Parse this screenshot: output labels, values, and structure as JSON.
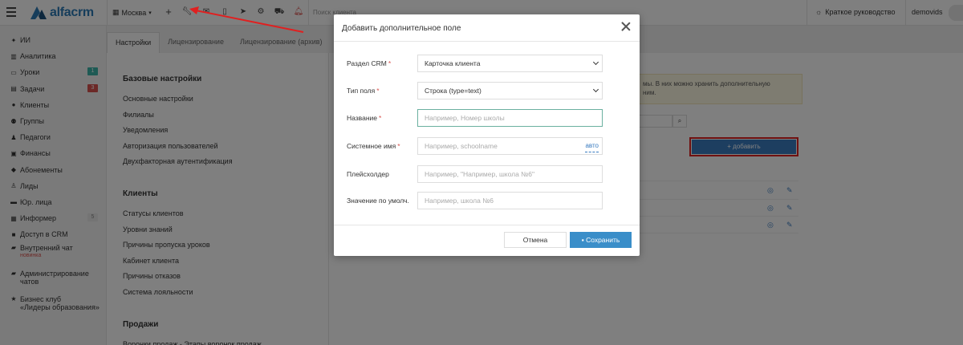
{
  "topbar": {
    "logo_text": "alfacrm",
    "city": "Москва",
    "search_placeholder": "Поиск клиента",
    "guide_label": "Краткое руководство",
    "username": "demovids"
  },
  "sidebar": {
    "items": [
      {
        "label": "ИИ",
        "icon": "sparkle-icon"
      },
      {
        "label": "Аналитика",
        "icon": "chart-icon"
      },
      {
        "label": "Уроки",
        "icon": "lessons-icon",
        "badge": "1",
        "badge_color": "#3cb4a8"
      },
      {
        "label": "Задачи",
        "icon": "tasks-icon",
        "badge": "3",
        "badge_color": "#d9534f"
      },
      {
        "label": "Клиенты",
        "icon": "user-icon"
      },
      {
        "label": "Группы",
        "icon": "group-icon"
      },
      {
        "label": "Педагоги",
        "icon": "teacher-icon"
      },
      {
        "label": "Финансы",
        "icon": "finance-icon"
      },
      {
        "label": "Абонементы",
        "icon": "tag-icon"
      },
      {
        "label": "Лиды",
        "icon": "leads-icon"
      },
      {
        "label": "Юр. лица",
        "icon": "briefcase-icon"
      },
      {
        "label": "Информер",
        "icon": "informer-icon",
        "badge": "5",
        "badge_color": "#e8e8e8"
      },
      {
        "label": "Доступ в CRM",
        "icon": "lock-icon"
      }
    ],
    "chat_label": "Внутренний чат",
    "chat_new": "новинка",
    "admin_chats": "Администрирование чатов",
    "business_club_line1": "Бизнес клуб",
    "business_club_line2": "«Лидеры образования»"
  },
  "tabs": [
    {
      "label": "Настройки"
    },
    {
      "label": "Лицензирование"
    },
    {
      "label": "Лицензирование (архив)"
    }
  ],
  "settings_menu": {
    "base_title": "Базовые настройки",
    "base_items": [
      "Основные настройки",
      "Филиалы",
      "Уведомления",
      "Авторизация пользователей",
      "Двухфакторная аутентификация"
    ],
    "clients_title": "Клиенты",
    "clients_items": [
      "Статусы клиентов",
      "Уровни знаний",
      "Причины пропуска уроков",
      "Кабинет клиента",
      "Причины отказов",
      "Система лояльности"
    ],
    "sales_title": "Продажи",
    "sales_items": [
      "Воронки продаж - Этапы воронок продаж"
    ]
  },
  "background": {
    "notice_line1": "мы. В них можно хранить дополнительную",
    "notice_line2": "ним.",
    "add_button": "+ добавить"
  },
  "modal": {
    "title": "Добавить дополнительное поле",
    "fields": {
      "section_label": "Раздел CRM",
      "section_value": "Карточка клиента",
      "type_label": "Тип поля",
      "type_value": "Строка (type=text)",
      "name_label": "Название",
      "name_placeholder": "Например, Номер школы",
      "sysname_label": "Системное имя",
      "sysname_placeholder": "Например, schoolname",
      "sysname_auto": "авто",
      "placeholder_label": "Плейсхолдер",
      "placeholder_placeholder": "Например, \"Например, школа №6\"",
      "default_label": "Значение по умолч.",
      "default_placeholder": "Например, школа №6"
    },
    "required_mark": "*",
    "cancel_label": "Отмена",
    "save_label": "Сохранить"
  },
  "colors": {
    "accent": "#3a8ec9",
    "highlight": "#e02020",
    "required": "#d9534f"
  }
}
